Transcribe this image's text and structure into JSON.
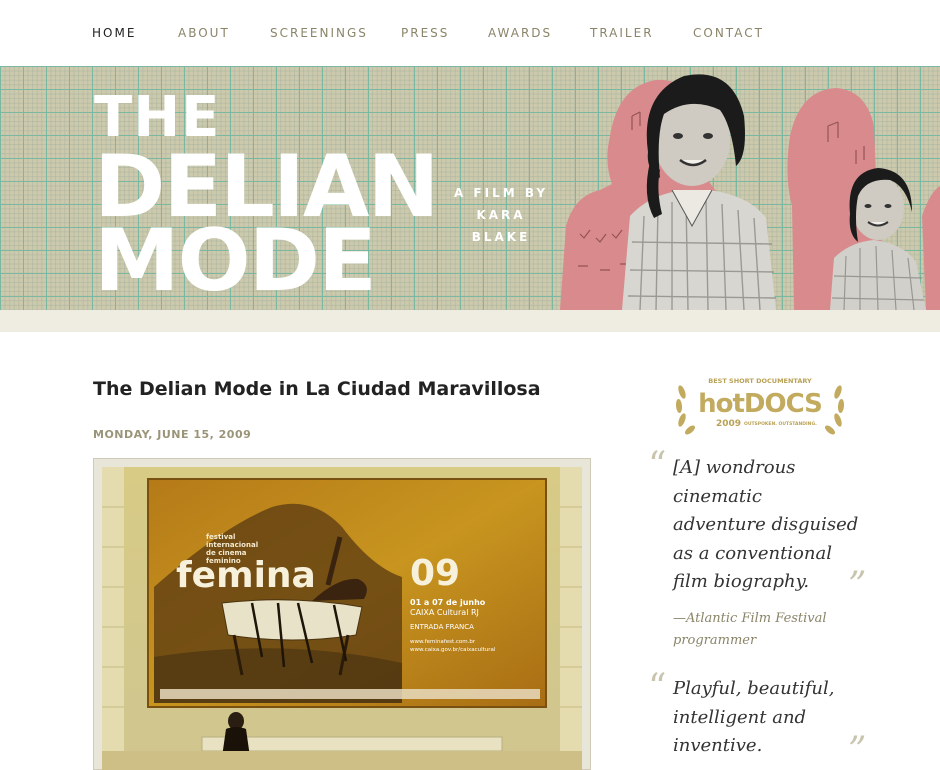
{
  "nav": {
    "items": [
      {
        "label": "HOME",
        "active": true
      },
      {
        "label": "ABOUT",
        "active": false
      },
      {
        "label": "SCREENINGS",
        "active": false
      },
      {
        "label": "PRESS",
        "active": false
      },
      {
        "label": "AWARDS",
        "active": false
      },
      {
        "label": "TRAILER",
        "active": false
      },
      {
        "label": "CONTACT",
        "active": false
      }
    ]
  },
  "banner": {
    "title_line1": "THE",
    "title_line2": "DELIAN",
    "title_line3": "MODE",
    "credit_line1": "A FILM BY",
    "credit_line2": "KARA",
    "credit_line3": "BLAKE"
  },
  "post": {
    "title": "The Delian Mode in La Ciudad Maravillosa",
    "date": "MONDAY, JUNE 15, 2009",
    "poster": {
      "festival_line1": "festival",
      "festival_line2": "internacional",
      "festival_line3": "de cinema",
      "festival_line4": "feminino",
      "name": "femina",
      "year": "09",
      "dates": "01 a 07 de junho",
      "venue": "CAIXA Cultural RJ",
      "entry": "ENTRADA FRANCA",
      "url1": "www.feminafest.com.br",
      "url2": "www.caixa.gov.br/caixacultural"
    }
  },
  "sidebar": {
    "award": {
      "line1": "BEST SHORT DOCUMENTARY",
      "name": "hotDOCS",
      "year": "2009",
      "tagline": "OUTSPOKEN. OUTSTANDING."
    },
    "quotes": [
      {
        "lines": [
          "[A] wondrous",
          "cinematic",
          "adventure disguised",
          "as a conventional",
          "film biography."
        ],
        "attribution": [
          "—Atlantic Film Festival",
          "programmer"
        ]
      },
      {
        "lines": [
          "Playful, beautiful,",
          "intelligent and",
          "inventive."
        ],
        "attribution": []
      }
    ]
  },
  "colors": {
    "banner_bg": "#ccc9ad",
    "grid": "#7ab8a2",
    "silhouette_pink": "#d98a8c",
    "accent_text": "#8a8468"
  }
}
